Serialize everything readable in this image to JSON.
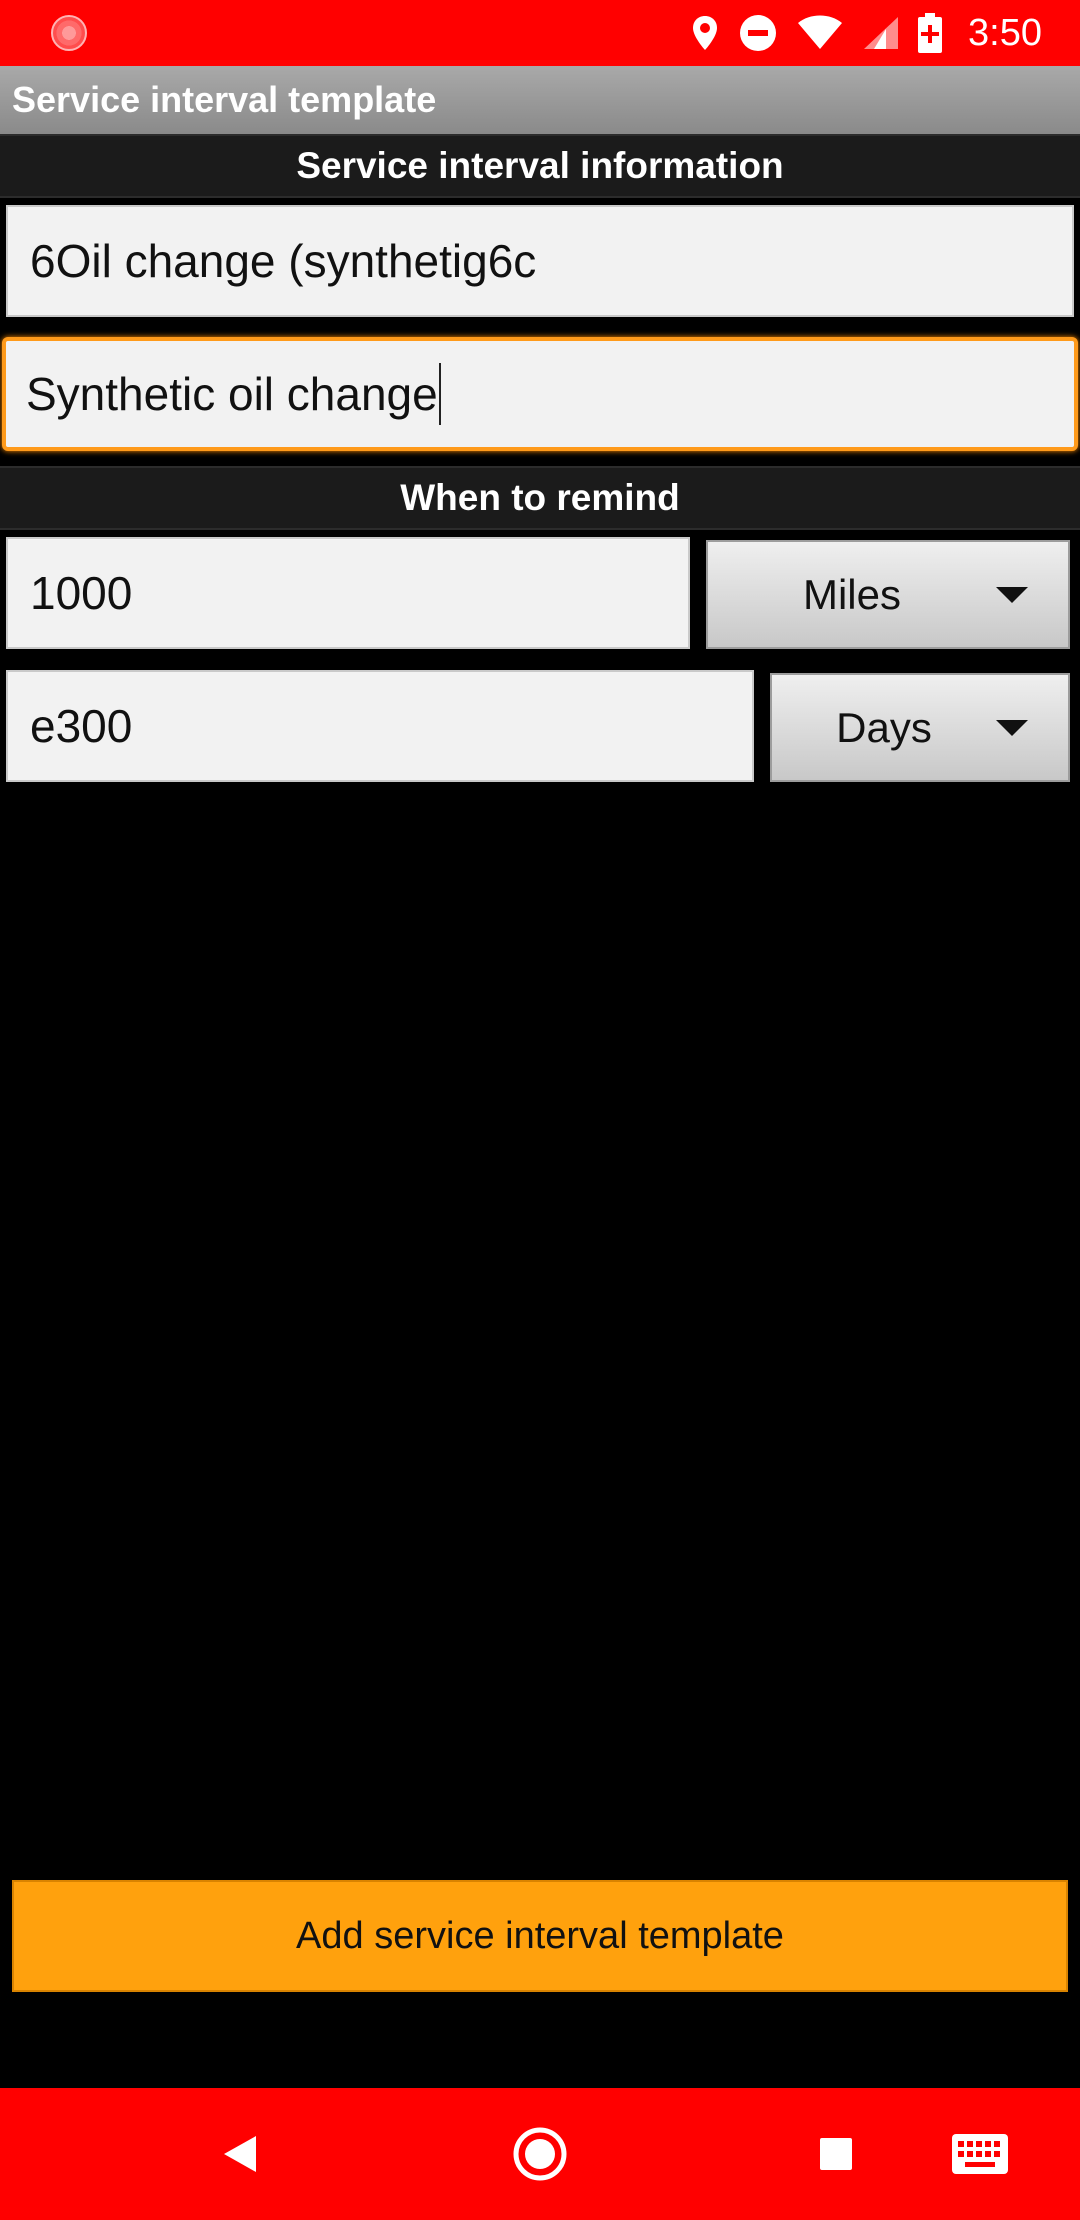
{
  "status_bar": {
    "time": "3:50",
    "icons": [
      "app-notification-icon",
      "location-icon",
      "do-not-disturb-icon",
      "wifi-icon",
      "cell-signal-icon",
      "battery-charging-icon"
    ]
  },
  "title_bar": {
    "title": "Service interval template"
  },
  "sections": {
    "info_header": "Service interval information",
    "remind_header": "When to remind"
  },
  "form": {
    "name_value": "6Oil change (synthetig6c",
    "description_value": "Synthetic oil change",
    "distance_value": "1000",
    "distance_unit": "Miles",
    "time_value": "e300",
    "time_unit": "Days"
  },
  "actions": {
    "add_label": "Add service interval template"
  },
  "nav_bar": {
    "buttons": [
      "back-icon",
      "home-icon",
      "recents-icon",
      "keyboard-icon"
    ]
  },
  "colors": {
    "status_bar": "#ff0000",
    "accent": "#ffa10d",
    "focus_border": "#ff9a1a"
  }
}
